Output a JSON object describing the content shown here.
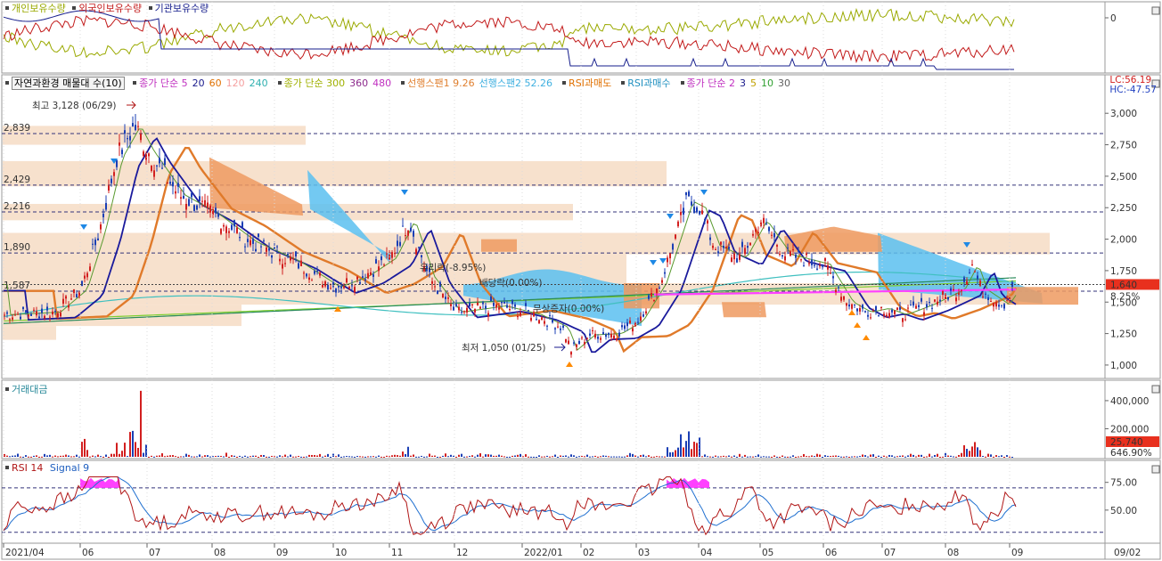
{
  "top_legend": {
    "items": [
      {
        "label": "개인보유수량",
        "color": "#9aa900"
      },
      {
        "label": "외국인보유수량",
        "color": "#c21a1a"
      },
      {
        "label": "기관보유수량",
        "color": "#151d8c"
      }
    ],
    "axis_value": "0"
  },
  "indicator_bar": {
    "primary_box": "자연과환경 매물대 수(10)",
    "items": [
      {
        "text": "종가 단순 5",
        "color": "#c030c0"
      },
      {
        "text": "20",
        "color": "#1a1a8c"
      },
      {
        "text": "60",
        "color": "#e07000"
      },
      {
        "text": "120",
        "color": "#f5a0a0"
      },
      {
        "text": "240",
        "color": "#30b0b0"
      },
      {
        "text": "종가 단순 300",
        "color": "#a0b000"
      },
      {
        "text": "360",
        "color": "#8c2a8c"
      },
      {
        "text": "480",
        "color": "#c030c0"
      },
      {
        "text": "선행스팬1 9.26",
        "color": "#e08030"
      },
      {
        "text": "선행스팬2 52.26",
        "color": "#40b0e0"
      },
      {
        "text": "RSI과매도",
        "color": "#e07000"
      },
      {
        "text": "RSI과매수",
        "color": "#2090c0"
      },
      {
        "text": "종가 단순 2",
        "color": "#c030c0"
      },
      {
        "text": "3",
        "color": "#1a1a8c"
      },
      {
        "text": "5",
        "color": "#c0a000"
      },
      {
        "text": "10",
        "color": "#30a030"
      },
      {
        "text": "30",
        "color": "#606060"
      }
    ],
    "lc": "LC:56.19",
    "hc": "HC:-47.57"
  },
  "price_panel": {
    "y_ticks": [
      "3,000",
      "2,750",
      "2,500",
      "2,250",
      "2,000",
      "1,750",
      "1,500",
      "1,250",
      "1,000"
    ],
    "levels": [
      "2,839",
      "2,429",
      "2,216",
      "1,890",
      "1,587"
    ],
    "annotations": {
      "high": "최고 3,128 (06/29)",
      "low": "최저 1,050 (01/25)",
      "a1": "유리락(-8.95%)",
      "a2": "배당락(0.00%)",
      "a3": "무상증자(0.00%)"
    },
    "current_price": "1,640",
    "current_pct": "8.25%"
  },
  "volume_panel": {
    "title": "거래대금",
    "y_ticks": [
      "400,000",
      "200,000"
    ],
    "current_value": "25,740",
    "current_pct": "646.90%"
  },
  "rsi_panel": {
    "title_rsi": "RSI 14",
    "title_signal": "Signal 9",
    "y_ticks": [
      "75.00",
      "50.00"
    ]
  },
  "x_axis": {
    "labels": [
      "2021/04",
      "06",
      "07",
      "08",
      "09",
      "10",
      "11",
      "12",
      "2022/01",
      "02",
      "03",
      "04",
      "05",
      "06",
      "07",
      "08",
      "09"
    ],
    "right_label": "09/02"
  },
  "chart_data": {
    "type": "line",
    "title": "",
    "x": [
      "2021/04",
      "05",
      "06",
      "07",
      "08",
      "09",
      "10",
      "11",
      "12",
      "2022/01",
      "02",
      "03",
      "04",
      "05",
      "06",
      "07",
      "08",
      "09"
    ],
    "series": [
      {
        "name": "",
        "values": [
          1350,
          1450,
          2000,
          2650,
          2200,
          1900,
          1550,
          1750,
          1450,
          1350,
          1180,
          1350,
          2150,
          1900,
          1700,
          1400,
          1550,
          1640
        ]
      }
    ],
    "ylim": [
      950,
      3150
    ],
    "events": [
      "최고 3,128 (06/29)",
      "최저 1,050 (01/25)"
    ],
    "colors": {
      "up": "#d21f1f",
      "down": "#1b3fb5",
      "ma20": "#1a1a9c",
      "ma60": "#e07a2a",
      "span1": "#e08030",
      "span2": "#40b0e0"
    }
  }
}
